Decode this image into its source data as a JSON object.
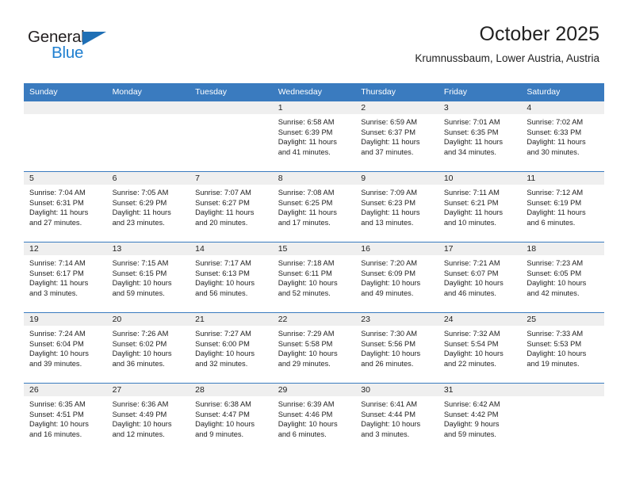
{
  "brand": {
    "name_dark": "General",
    "name_blue": "Blue",
    "accent_color": "#3a7bbf",
    "logo_blue": "#1f7fd0"
  },
  "header": {
    "title": "October 2025",
    "subtitle": "Krumnussbaum, Lower Austria, Austria"
  },
  "calendar": {
    "weekday_headers": [
      "Sunday",
      "Monday",
      "Tuesday",
      "Wednesday",
      "Thursday",
      "Friday",
      "Saturday"
    ],
    "weeks": [
      [
        {
          "day": "",
          "lines": []
        },
        {
          "day": "",
          "lines": []
        },
        {
          "day": "",
          "lines": []
        },
        {
          "day": "1",
          "lines": [
            "Sunrise: 6:58 AM",
            "Sunset: 6:39 PM",
            "Daylight: 11 hours",
            "and 41 minutes."
          ]
        },
        {
          "day": "2",
          "lines": [
            "Sunrise: 6:59 AM",
            "Sunset: 6:37 PM",
            "Daylight: 11 hours",
            "and 37 minutes."
          ]
        },
        {
          "day": "3",
          "lines": [
            "Sunrise: 7:01 AM",
            "Sunset: 6:35 PM",
            "Daylight: 11 hours",
            "and 34 minutes."
          ]
        },
        {
          "day": "4",
          "lines": [
            "Sunrise: 7:02 AM",
            "Sunset: 6:33 PM",
            "Daylight: 11 hours",
            "and 30 minutes."
          ]
        }
      ],
      [
        {
          "day": "5",
          "lines": [
            "Sunrise: 7:04 AM",
            "Sunset: 6:31 PM",
            "Daylight: 11 hours",
            "and 27 minutes."
          ]
        },
        {
          "day": "6",
          "lines": [
            "Sunrise: 7:05 AM",
            "Sunset: 6:29 PM",
            "Daylight: 11 hours",
            "and 23 minutes."
          ]
        },
        {
          "day": "7",
          "lines": [
            "Sunrise: 7:07 AM",
            "Sunset: 6:27 PM",
            "Daylight: 11 hours",
            "and 20 minutes."
          ]
        },
        {
          "day": "8",
          "lines": [
            "Sunrise: 7:08 AM",
            "Sunset: 6:25 PM",
            "Daylight: 11 hours",
            "and 17 minutes."
          ]
        },
        {
          "day": "9",
          "lines": [
            "Sunrise: 7:09 AM",
            "Sunset: 6:23 PM",
            "Daylight: 11 hours",
            "and 13 minutes."
          ]
        },
        {
          "day": "10",
          "lines": [
            "Sunrise: 7:11 AM",
            "Sunset: 6:21 PM",
            "Daylight: 11 hours",
            "and 10 minutes."
          ]
        },
        {
          "day": "11",
          "lines": [
            "Sunrise: 7:12 AM",
            "Sunset: 6:19 PM",
            "Daylight: 11 hours",
            "and 6 minutes."
          ]
        }
      ],
      [
        {
          "day": "12",
          "lines": [
            "Sunrise: 7:14 AM",
            "Sunset: 6:17 PM",
            "Daylight: 11 hours",
            "and 3 minutes."
          ]
        },
        {
          "day": "13",
          "lines": [
            "Sunrise: 7:15 AM",
            "Sunset: 6:15 PM",
            "Daylight: 10 hours",
            "and 59 minutes."
          ]
        },
        {
          "day": "14",
          "lines": [
            "Sunrise: 7:17 AM",
            "Sunset: 6:13 PM",
            "Daylight: 10 hours",
            "and 56 minutes."
          ]
        },
        {
          "day": "15",
          "lines": [
            "Sunrise: 7:18 AM",
            "Sunset: 6:11 PM",
            "Daylight: 10 hours",
            "and 52 minutes."
          ]
        },
        {
          "day": "16",
          "lines": [
            "Sunrise: 7:20 AM",
            "Sunset: 6:09 PM",
            "Daylight: 10 hours",
            "and 49 minutes."
          ]
        },
        {
          "day": "17",
          "lines": [
            "Sunrise: 7:21 AM",
            "Sunset: 6:07 PM",
            "Daylight: 10 hours",
            "and 46 minutes."
          ]
        },
        {
          "day": "18",
          "lines": [
            "Sunrise: 7:23 AM",
            "Sunset: 6:05 PM",
            "Daylight: 10 hours",
            "and 42 minutes."
          ]
        }
      ],
      [
        {
          "day": "19",
          "lines": [
            "Sunrise: 7:24 AM",
            "Sunset: 6:04 PM",
            "Daylight: 10 hours",
            "and 39 minutes."
          ]
        },
        {
          "day": "20",
          "lines": [
            "Sunrise: 7:26 AM",
            "Sunset: 6:02 PM",
            "Daylight: 10 hours",
            "and 36 minutes."
          ]
        },
        {
          "day": "21",
          "lines": [
            "Sunrise: 7:27 AM",
            "Sunset: 6:00 PM",
            "Daylight: 10 hours",
            "and 32 minutes."
          ]
        },
        {
          "day": "22",
          "lines": [
            "Sunrise: 7:29 AM",
            "Sunset: 5:58 PM",
            "Daylight: 10 hours",
            "and 29 minutes."
          ]
        },
        {
          "day": "23",
          "lines": [
            "Sunrise: 7:30 AM",
            "Sunset: 5:56 PM",
            "Daylight: 10 hours",
            "and 26 minutes."
          ]
        },
        {
          "day": "24",
          "lines": [
            "Sunrise: 7:32 AM",
            "Sunset: 5:54 PM",
            "Daylight: 10 hours",
            "and 22 minutes."
          ]
        },
        {
          "day": "25",
          "lines": [
            "Sunrise: 7:33 AM",
            "Sunset: 5:53 PM",
            "Daylight: 10 hours",
            "and 19 minutes."
          ]
        }
      ],
      [
        {
          "day": "26",
          "lines": [
            "Sunrise: 6:35 AM",
            "Sunset: 4:51 PM",
            "Daylight: 10 hours",
            "and 16 minutes."
          ]
        },
        {
          "day": "27",
          "lines": [
            "Sunrise: 6:36 AM",
            "Sunset: 4:49 PM",
            "Daylight: 10 hours",
            "and 12 minutes."
          ]
        },
        {
          "day": "28",
          "lines": [
            "Sunrise: 6:38 AM",
            "Sunset: 4:47 PM",
            "Daylight: 10 hours",
            "and 9 minutes."
          ]
        },
        {
          "day": "29",
          "lines": [
            "Sunrise: 6:39 AM",
            "Sunset: 4:46 PM",
            "Daylight: 10 hours",
            "and 6 minutes."
          ]
        },
        {
          "day": "30",
          "lines": [
            "Sunrise: 6:41 AM",
            "Sunset: 4:44 PM",
            "Daylight: 10 hours",
            "and 3 minutes."
          ]
        },
        {
          "day": "31",
          "lines": [
            "Sunrise: 6:42 AM",
            "Sunset: 4:42 PM",
            "Daylight: 9 hours",
            "and 59 minutes."
          ]
        },
        {
          "day": "",
          "lines": []
        }
      ]
    ]
  }
}
